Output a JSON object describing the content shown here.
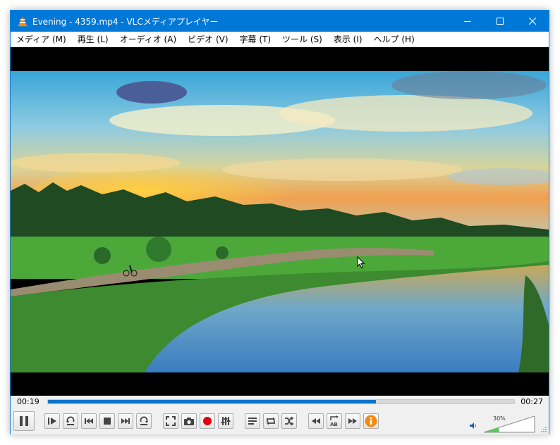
{
  "window": {
    "title": "Evening - 4359.mp4 - VLCメディアプレイヤー"
  },
  "menu": [
    "メディア (M)",
    "再生 (L)",
    "オーディオ (A)",
    "ビデオ (V)",
    "字幕 (T)",
    "ツール (S)",
    "表示 (I)",
    "ヘルプ (H)"
  ],
  "playback": {
    "elapsed": "00:19",
    "total": "00:27",
    "progress_fraction": 0.704
  },
  "volume": {
    "label": "30%",
    "level_fraction": 0.3
  },
  "colors": {
    "titlebar": "#0078d7",
    "seek_fill": "#0f74c9",
    "record": "#e0000f",
    "info": "#f28c10",
    "volume_fill": "#5cc85c"
  },
  "icons": {
    "pause": "pause-icon",
    "play_frame": "frame-step-icon",
    "prev": "previous-icon",
    "stop": "stop-icon",
    "next": "next-icon",
    "fullscreen": "fullscreen-icon",
    "snapshot": "camera-icon",
    "record": "record-icon",
    "equalizer": "equalizer-icon",
    "playlist": "playlist-icon",
    "loop": "loop-icon",
    "shuffle": "shuffle-icon",
    "slower": "rewind-icon",
    "ab_loop": "ab-loop-icon",
    "faster": "fast-forward-icon",
    "info": "info-icon",
    "speaker": "speaker-icon"
  }
}
